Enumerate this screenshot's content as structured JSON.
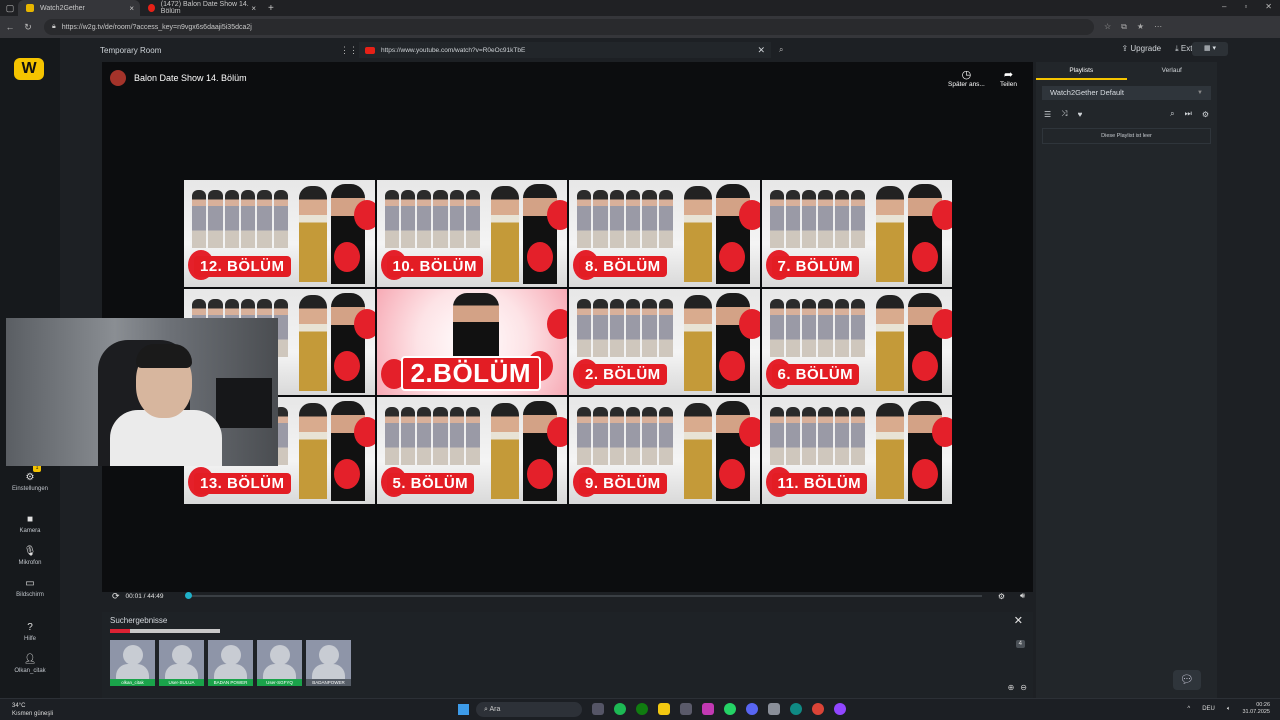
{
  "browser": {
    "tabs": [
      {
        "title": "Watch2Gether",
        "icon": "w2g-favicon",
        "active": true
      },
      {
        "title": "(1472) Balon Date Show 14. Bölüm",
        "icon": "youtube-favicon",
        "active": false
      }
    ],
    "url": "https://w2g.tv/de/room/?access_key=n9vgx6s6daaji5i35dca2j"
  },
  "room": {
    "name": "Temporary Room",
    "video_url": "https://www.youtube.com/watch?v=R0eOc91kTbE",
    "upgrade_label": "Upgrade",
    "extension_label": "Extension"
  },
  "leftnav": {
    "settings": {
      "label": "Einstellungen",
      "badge": "1"
    },
    "camera": "Kamera",
    "mic": "Mikrofon",
    "screen": "Bildschirm",
    "help": "Hilfe",
    "user": "Olkan_citak"
  },
  "video": {
    "title": "Balon Date Show 14. Bölüm",
    "watch_later": "Später ans...",
    "share": "Teilen",
    "thumbnails": [
      "12. BÖLÜM",
      "10. BÖLÜM",
      "8. BÖLÜM",
      "7. BÖLÜM",
      "",
      "2.BÖLÜM",
      "2. BÖLÜM",
      "6. BÖLÜM",
      "13. BÖLÜM",
      "5. BÖLÜM",
      "9. BÖLÜM",
      "11. BÖLÜM"
    ],
    "time": "00:01 / 44:49",
    "progress": 0.0004
  },
  "webcam": {
    "label": "olkan_citak"
  },
  "search": {
    "title": "Suchergebnisse",
    "count": "4",
    "users": [
      "olkan_citak",
      "User-SULUA",
      "BADAN POWER",
      "User-SGFYQ",
      "BADANPOWER"
    ]
  },
  "playlist": {
    "tabs": [
      "Playlists",
      "Verlauf"
    ],
    "selected": "Watch2Gether Default",
    "empty": "Diese Playlist ist leer"
  },
  "taskbar": {
    "temp": "34°C",
    "weather": "Kısmen güneşli",
    "search": "Ara",
    "lang": "DEU",
    "time": "00:26",
    "date": "31.07.2025"
  },
  "colors": {
    "accent": "#f5c400",
    "seek": "#1fb1c9",
    "badge_red": "#e31d24"
  }
}
